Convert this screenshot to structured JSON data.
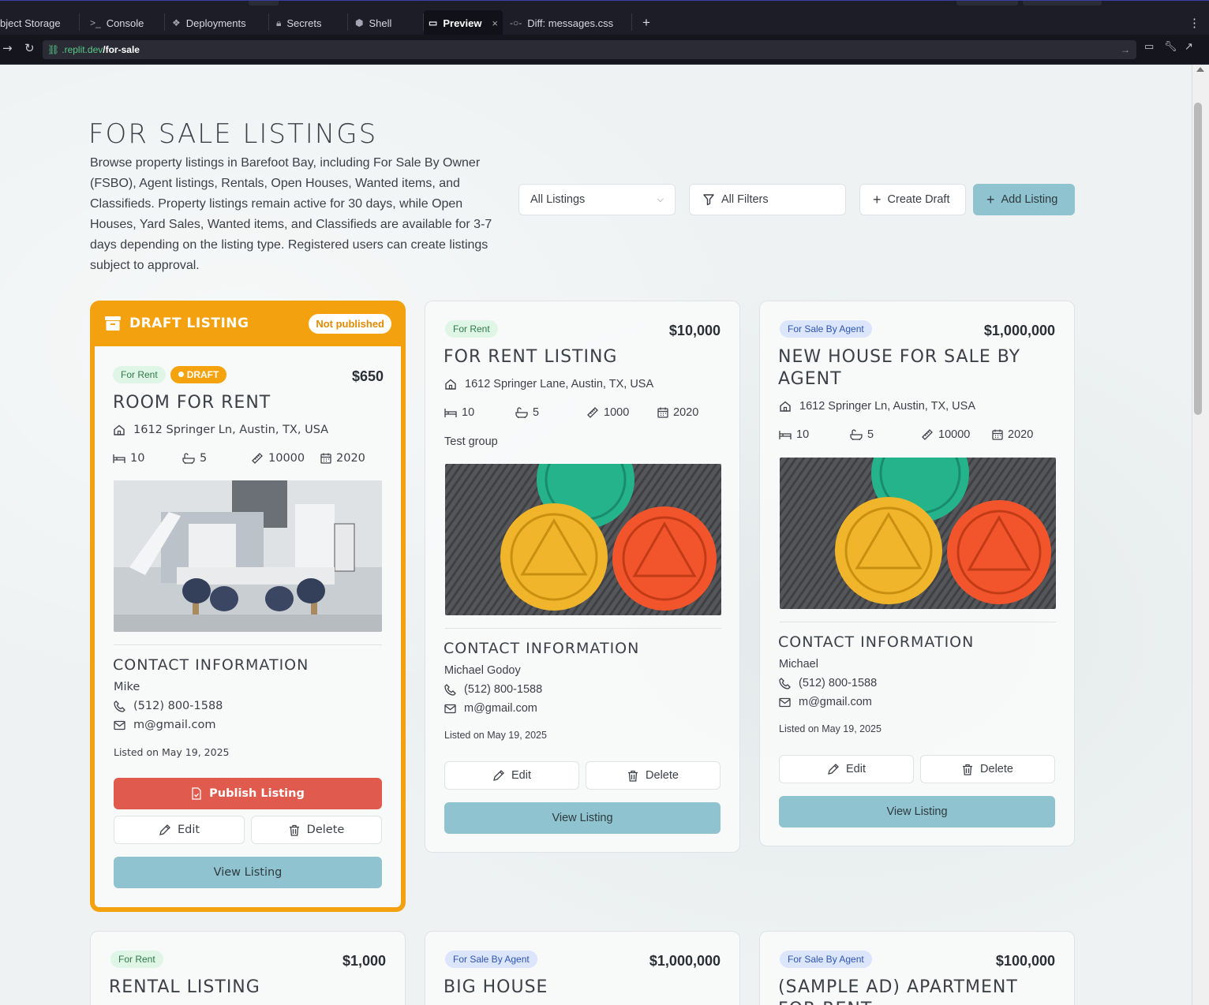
{
  "tabs": [
    {
      "label": "bject Storage",
      "icon": "database-icon"
    },
    {
      "label": "Console",
      "icon": "terminal-icon"
    },
    {
      "label": "Deployments",
      "icon": "deploy-icon"
    },
    {
      "label": "Secrets",
      "icon": "lock-icon"
    },
    {
      "label": "Shell",
      "icon": "shell-icon"
    },
    {
      "label": "Preview",
      "icon": "monitor-icon",
      "active": true
    },
    {
      "label": "Diff: messages.css",
      "icon": "git-commit-icon"
    }
  ],
  "url": {
    "domain": ".replit.dev",
    "path": "/for-sale"
  },
  "page": {
    "title": "FOR SALE LISTINGS",
    "description": "Browse property listings in Barefoot Bay, including For Sale By Owner (FSBO), Agent listings, Rentals, Open Houses, Wanted items, and Classifieds. Property listings remain active for 30 days, while Open Houses, Yard Sales, Wanted items, and Classifieds are available for 3-7 days depending on the listing type. Registered users can create listings subject to approval."
  },
  "controls": {
    "select_value": "All Listings",
    "filters_label": "All Filters",
    "create_draft_label": "Create Draft",
    "add_listing_label": "Add Listing"
  },
  "draft_card": {
    "header": "DRAFT LISTING",
    "status": "Not published",
    "badge_type": "For Rent",
    "badge_draft": "DRAFT",
    "price": "$650",
    "title": "ROOM FOR RENT",
    "address": "1612 Springer Ln, Austin, TX, USA",
    "beds": "10",
    "baths": "5",
    "sqft": "10000",
    "year": "2020",
    "contact_heading": "CONTACT INFORMATION",
    "contact_name": "Mike",
    "phone": "(512) 800-1588",
    "email": "m@gmail.com",
    "listed": "Listed on May 19, 2025",
    "publish_label": "Publish Listing",
    "edit_label": "Edit",
    "delete_label": "Delete",
    "view_label": "View Listing"
  },
  "card2": {
    "badge_type": "For Rent",
    "price": "$10,000",
    "title": "FOR RENT LISTING",
    "address": "1612 Springer Lane, Austin, TX, USA",
    "beds": "10",
    "baths": "5",
    "sqft": "1000",
    "year": "2020",
    "group": "Test group",
    "contact_heading": "CONTACT INFORMATION",
    "contact_name": "Michael Godoy",
    "phone": "(512) 800-1588",
    "email": "m@gmail.com",
    "listed": "Listed on May 19, 2025",
    "edit_label": "Edit",
    "delete_label": "Delete",
    "view_label": "View Listing"
  },
  "card3": {
    "badge_type": "For Sale By Agent",
    "price": "$1,000,000",
    "title_line1": "NEW HOUSE FOR SALE BY",
    "title_line2": "AGENT",
    "address": "1612 Springer Ln, Austin, TX, USA",
    "beds": "10",
    "baths": "5",
    "sqft": "10000",
    "year": "2020",
    "contact_heading": "CONTACT INFORMATION",
    "contact_name": "Michael",
    "phone": "(512) 800-1588",
    "email": "m@gmail.com",
    "listed": "Listed on May 19, 2025",
    "edit_label": "Edit",
    "delete_label": "Delete",
    "view_label": "View Listing"
  },
  "row2": [
    {
      "badge_type": "For Rent",
      "price": "$1,000",
      "title": "RENTAL LISTING"
    },
    {
      "badge_type": "For Sale By Agent",
      "price": "$1,000,000",
      "title": "BIG HOUSE"
    },
    {
      "badge_type": "For Sale By Agent",
      "price": "$100,000",
      "title": "(SAMPLE AD) APARTMENT",
      "title_line2": "FOR RENT"
    }
  ],
  "colors": {
    "accent": "#f4a10f",
    "view_button": "#8fc3cf",
    "publish_button": "#e05a4d"
  }
}
